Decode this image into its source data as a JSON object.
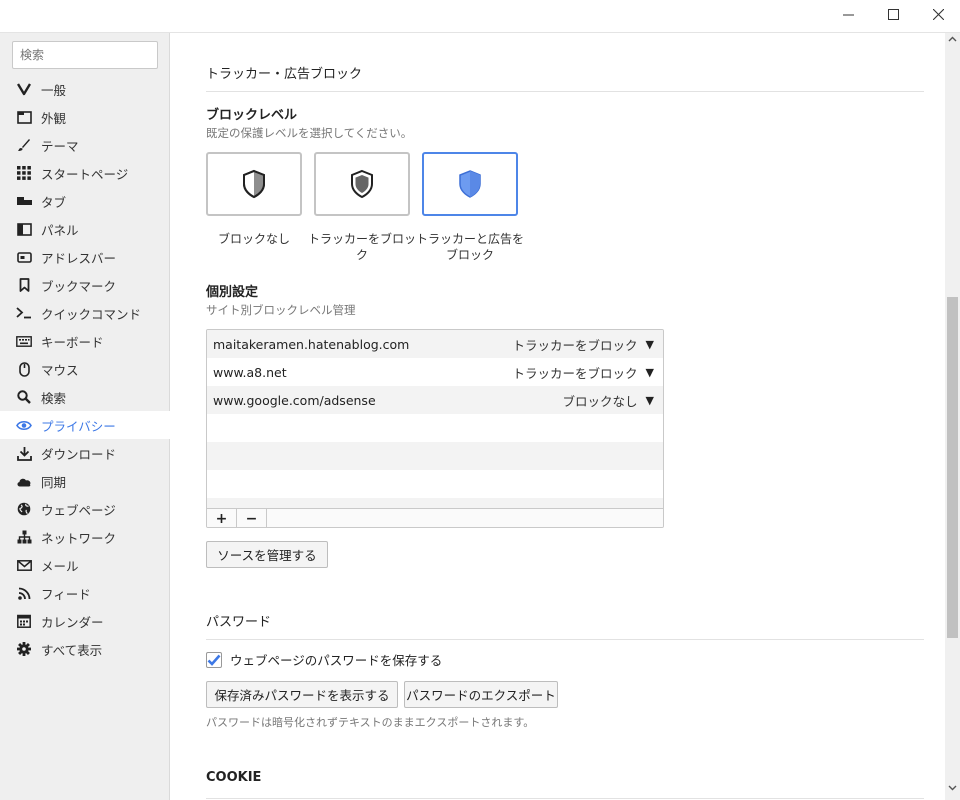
{
  "window": {
    "controls": [
      "minimize-icon",
      "maximize-icon",
      "close-icon"
    ]
  },
  "sidebar": {
    "search_placeholder": "検索",
    "items": [
      {
        "label": "一般",
        "icon": "vivaldi-v-icon"
      },
      {
        "label": "外観",
        "icon": "folder-window-icon"
      },
      {
        "label": "テーマ",
        "icon": "brush-icon"
      },
      {
        "label": "スタートページ",
        "icon": "grid-icon"
      },
      {
        "label": "タブ",
        "icon": "tab-icon"
      },
      {
        "label": "パネル",
        "icon": "panel-icon"
      },
      {
        "label": "アドレスバー",
        "icon": "address-bar-icon"
      },
      {
        "label": "ブックマーク",
        "icon": "bookmark-icon"
      },
      {
        "label": "クイックコマンド",
        "icon": "quick-command-icon"
      },
      {
        "label": "キーボード",
        "icon": "keyboard-icon"
      },
      {
        "label": "マウス",
        "icon": "mouse-icon"
      },
      {
        "label": "検索",
        "icon": "search-icon"
      },
      {
        "label": "プライバシー",
        "icon": "eye-icon",
        "active": true
      },
      {
        "label": "ダウンロード",
        "icon": "download-icon"
      },
      {
        "label": "同期",
        "icon": "cloud-icon"
      },
      {
        "label": "ウェブページ",
        "icon": "globe-icon"
      },
      {
        "label": "ネットワーク",
        "icon": "network-icon"
      },
      {
        "label": "メール",
        "icon": "mail-icon"
      },
      {
        "label": "フィード",
        "icon": "feed-icon"
      },
      {
        "label": "カレンダー",
        "icon": "calendar-icon"
      },
      {
        "label": "すべて表示",
        "icon": "gear-icon"
      }
    ]
  },
  "tracker": {
    "section_title": "トラッカー・広告ブロック",
    "block_level": {
      "heading": "ブロックレベル",
      "description": "既定の保護レベルを選択してください。",
      "options": [
        {
          "label": "ブロックなし",
          "icon": "shield-half-icon"
        },
        {
          "label": "トラッカーをブロック",
          "icon": "shield-dark-icon"
        },
        {
          "label": "トラッカーと広告を\nブロック",
          "icon": "shield-blue-icon",
          "selected": true
        }
      ]
    },
    "per_site": {
      "heading": "個別設定",
      "description": "サイト別ブロックレベル管理",
      "rows": [
        {
          "site": "maitakeramen.hatenablog.com",
          "level": "トラッカーをブロック"
        },
        {
          "site": "www.a8.net",
          "level": "トラッカーをブロック"
        },
        {
          "site": "www.google.com/adsense",
          "level": "ブロックなし"
        }
      ],
      "add_label": "+",
      "remove_label": "−"
    },
    "manage_sources_label": "ソースを管理する"
  },
  "password": {
    "section_title": "パスワード",
    "save_checkbox_label": "ウェブページのパスワードを保存する",
    "save_checked": true,
    "show_saved_label": "保存済みパスワードを表示する",
    "export_label": "パスワードのエクスポート",
    "export_note": "パスワードは暗号化されずテキストのままエクスポートされます。"
  },
  "cookie": {
    "section_title": "COOKIE"
  },
  "colors": {
    "accent": "#3d78e6",
    "shield_blue": "#6d9bf0",
    "sidebar_bg": "#efefef"
  }
}
